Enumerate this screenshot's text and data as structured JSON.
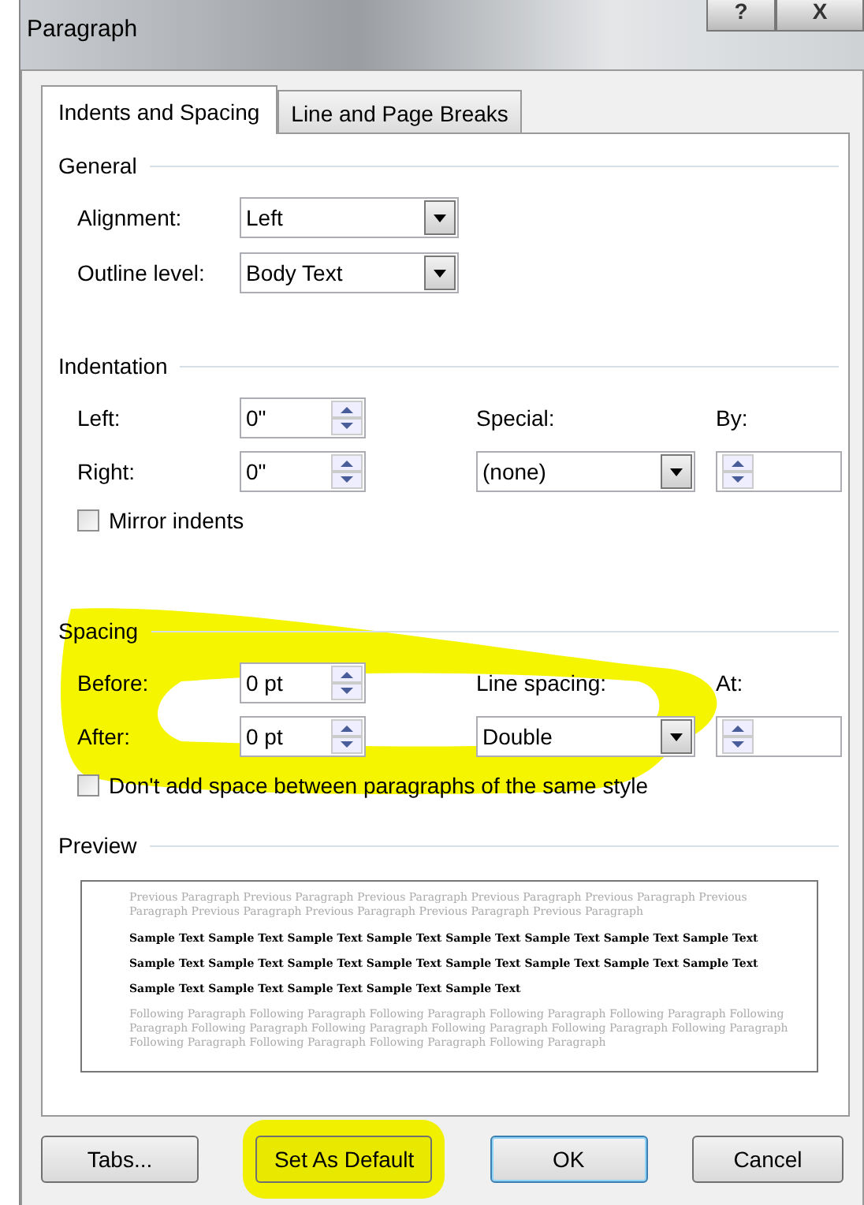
{
  "window": {
    "title": "Paragraph"
  },
  "title_buttons": [
    {
      "label": "?"
    },
    {
      "label": "X"
    }
  ],
  "tabs": [
    {
      "label": "Indents and Spacing",
      "selected": true
    },
    {
      "label": "Line and Page Breaks",
      "selected": false
    }
  ],
  "general": {
    "heading": "General",
    "rows": [
      {
        "label": "Alignment:",
        "value": "Left"
      },
      {
        "label": "Outline level:",
        "value": "Body Text"
      }
    ]
  },
  "indentation": {
    "heading": "Indentation",
    "left": {
      "label": "Left:",
      "value": "0\""
    },
    "right": {
      "label": "Right:",
      "value": "0\""
    },
    "special": {
      "label": "Special:",
      "value": "(none)"
    },
    "by": {
      "label": "By:"
    },
    "mirror": {
      "label": "Mirror indents",
      "checked": false
    }
  },
  "spacing": {
    "heading": "Spacing",
    "highlighted": true,
    "before": {
      "label": "Before:",
      "value": "0 pt"
    },
    "after": {
      "label": "After:",
      "value": "0 pt"
    },
    "line_spacing": {
      "label": "Line spacing:",
      "value": "Double"
    },
    "at": {
      "label": "At:"
    },
    "dont_add": {
      "label": "Don't add space between paragraphs of the same style",
      "checked": false
    }
  },
  "preview": {
    "heading": "Preview",
    "previous": "Previous Paragraph Previous Paragraph Previous Paragraph Previous Paragraph Previous Paragraph Previous Paragraph Previous Paragraph Previous Paragraph Previous Paragraph Previous Paragraph",
    "sample": "Sample Text Sample Text Sample Text Sample Text Sample Text Sample Text Sample Text Sample Text Sample Text Sample Text Sample Text Sample Text Sample Text Sample Text Sample Text Sample Text Sample Text Sample Text Sample Text Sample Text Sample Text",
    "following": "Following Paragraph Following Paragraph Following Paragraph Following Paragraph Following Paragraph Following Paragraph Following Paragraph Following Paragraph Following Paragraph Following Paragraph Following Paragraph Following Paragraph Following Paragraph Following Paragraph Following Paragraph"
  },
  "buttons": [
    {
      "label": "Tabs...",
      "kind": "normal",
      "highlighted": false
    },
    {
      "label": "Set As Default",
      "kind": "normal",
      "highlighted": true
    },
    {
      "label": "OK",
      "kind": "default",
      "highlighted": false
    },
    {
      "label": "Cancel",
      "kind": "normal",
      "highlighted": false
    }
  ]
}
